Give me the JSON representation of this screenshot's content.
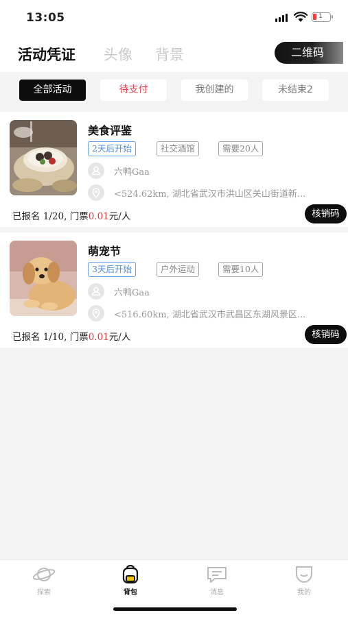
{
  "status_bar": {
    "time": "13:05",
    "battery_level": "1"
  },
  "top_nav": {
    "tabs": [
      {
        "label": "活动凭证",
        "active": true
      },
      {
        "label": "头像",
        "active": false
      },
      {
        "label": "背景",
        "active": false
      }
    ],
    "qr_button": "二维码"
  },
  "filters": [
    {
      "label": "全部活动",
      "active": true
    },
    {
      "label": "待支付",
      "active": false
    },
    {
      "label": "我创建的",
      "active": false
    },
    {
      "label": "未结束2",
      "active": false
    }
  ],
  "activities": [
    {
      "title": "美食评鉴",
      "tags": [
        "2天后开始",
        "社交酒馆",
        "需要20人"
      ],
      "organizer": "六鸭Gaa",
      "location": "<524.62km, 湖北省武汉市洪山区关山街道新...",
      "signup_prefix": "已报名 1/20,   门票",
      "price": "0.01",
      "price_unit": "元/人",
      "verify_button": "核销码"
    },
    {
      "title": "萌宠节",
      "tags": [
        "3天后开始",
        "户外运动",
        "需要10人"
      ],
      "organizer": "六鸭Gaa",
      "location": "<516.60km, 湖北省武汉市武昌区东湖风景区...",
      "signup_prefix": "已报名 1/10,   门票",
      "price": "0.01",
      "price_unit": "元/人",
      "verify_button": "核销码"
    }
  ],
  "bottom_nav": [
    {
      "label": "探索",
      "icon": "planet-icon",
      "active": false
    },
    {
      "label": "背包",
      "icon": "backpack-icon",
      "active": true
    },
    {
      "label": "消息",
      "icon": "message-icon",
      "active": false
    },
    {
      "label": "我的",
      "icon": "profile-icon",
      "active": false
    }
  ],
  "colors": {
    "accent": "#0d0d0d",
    "price_red": "#d83a3a",
    "tag_blue": "#4c8de0",
    "pending_pink": "#e04a58"
  }
}
